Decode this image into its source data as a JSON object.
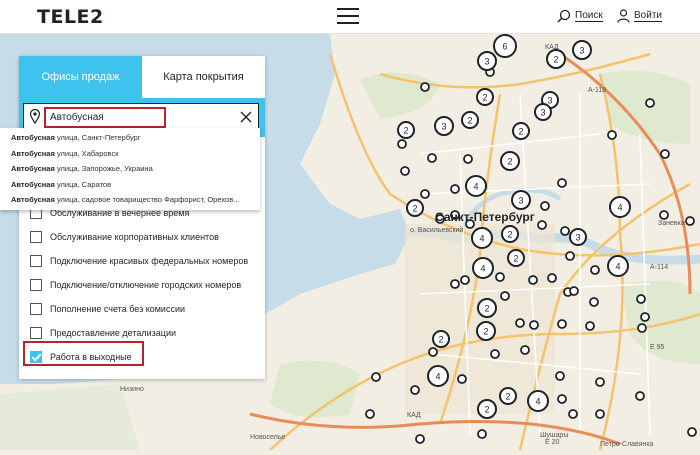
{
  "header": {
    "logo": "TELE2",
    "search_label": "Поиск",
    "login_label": "Войти"
  },
  "panel": {
    "tabs": [
      {
        "label": "Офисы продаж",
        "active": true
      },
      {
        "label": "Карта покрытия",
        "active": false
      }
    ],
    "search": {
      "value": "Автобусная"
    },
    "suggestions": [
      {
        "match": "Автобусная",
        "rest": " улица, Санкт-Петербург"
      },
      {
        "match": "Автобусная",
        "rest": " улица, Хабаровск"
      },
      {
        "match": "Автобусная",
        "rest": " улица, Запорожье, Украина"
      },
      {
        "match": "Автобусная",
        "rest": " улица, Саратов"
      },
      {
        "match": "Автобусная",
        "rest": " улица, садовое товарищество Фарфорист, Орехов..."
      }
    ],
    "filters": [
      {
        "label": "Обслуживание в вечернее время",
        "checked": false
      },
      {
        "label": "Обслуживание корпоративных клиентов",
        "checked": false
      },
      {
        "label": "Подключение красивых федеральных номеров",
        "checked": false
      },
      {
        "label": "Подключение/отключение городских номеров",
        "checked": false
      },
      {
        "label": "Пополнение счета без комиссии",
        "checked": false
      },
      {
        "label": "Предоставление детализации",
        "checked": false
      },
      {
        "label": "Работа в выходные",
        "checked": true
      }
    ]
  },
  "map": {
    "city": "Санкт-Петербург",
    "labels": {
      "vasilevsky": "о. Васильевский",
      "zanevka": "Заневка",
      "nizino": "Низино",
      "shushary": "Шушары",
      "novoselye": "Новоселье",
      "petroslavyanka": "Петро-Славянка",
      "kad1": "КАД",
      "kad2": "КАД",
      "a118": "А-118",
      "a114": "А-114",
      "e20": "Е 20",
      "e95": "Е 95"
    },
    "clusters": [
      {
        "count": "6"
      },
      {
        "count": "3"
      },
      {
        "count": "2"
      },
      {
        "count": "3"
      },
      {
        "count": "3"
      },
      {
        "count": "2"
      },
      {
        "count": "3"
      },
      {
        "count": "3"
      },
      {
        "count": "2"
      },
      {
        "count": "2"
      },
      {
        "count": "2"
      },
      {
        "count": "2"
      },
      {
        "count": "4"
      },
      {
        "count": "3"
      },
      {
        "count": "2"
      },
      {
        "count": "4"
      },
      {
        "count": "2"
      },
      {
        "count": "3"
      },
      {
        "count": "4"
      },
      {
        "count": "2"
      },
      {
        "count": "4"
      },
      {
        "count": "4"
      },
      {
        "count": "2"
      },
      {
        "count": "2"
      },
      {
        "count": "2"
      },
      {
        "count": "4"
      },
      {
        "count": "2"
      },
      {
        "count": "4"
      },
      {
        "count": "2"
      }
    ]
  },
  "colors": {
    "accent": "#3ec3ef",
    "highlight": "#b4232f",
    "text": "#1f2229"
  }
}
